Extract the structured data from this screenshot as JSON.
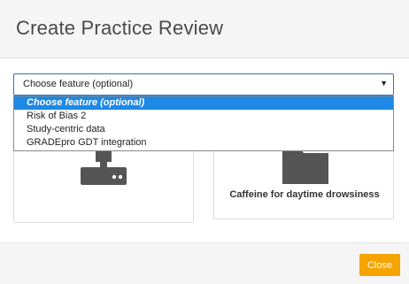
{
  "dialog": {
    "title": "Create Practice Review"
  },
  "feature_select": {
    "selected_value": "Choose feature (optional)",
    "caret": "▼",
    "options": [
      {
        "label": "Choose feature (optional)",
        "selected": true
      },
      {
        "label": "Risk of Bias 2",
        "selected": false
      },
      {
        "label": "Study-centric data",
        "selected": false
      },
      {
        "label": "GRADEpro GDT integration",
        "selected": false
      }
    ]
  },
  "cards": [
    {
      "icon": "server-icon",
      "label": ""
    },
    {
      "icon": "folder-icon",
      "label": "Caffeine for daytime drowsiness"
    }
  ],
  "footer": {
    "close_label": "Close"
  },
  "colors": {
    "accent": "#1e88e5",
    "close_button": "#f5a300",
    "select_border": "#3a6fb4",
    "icon": "#555555"
  }
}
